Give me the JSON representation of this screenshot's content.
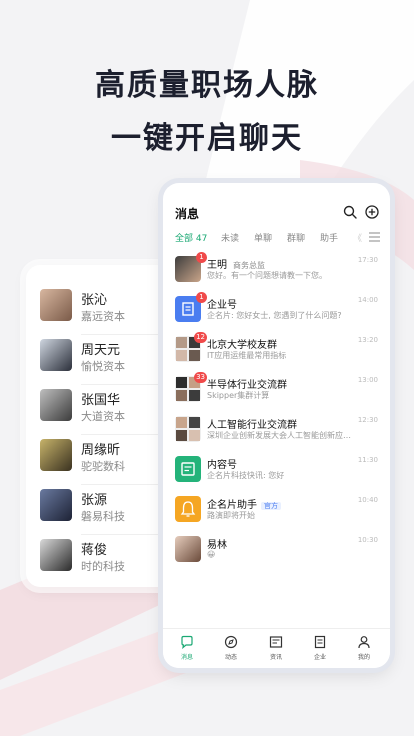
{
  "headline": {
    "line1": "高质量职场人脉",
    "line2": "一键开启聊天"
  },
  "contacts": [
    {
      "name": "张沁",
      "company": "嘉远资本"
    },
    {
      "name": "周天元",
      "company": "愉悦资本"
    },
    {
      "name": "张国华",
      "company": "大道资本"
    },
    {
      "name": "周缘昕",
      "company": "驼驼数科"
    },
    {
      "name": "张源",
      "company": "磐易科技"
    },
    {
      "name": "蒋俊",
      "company": "时的科技"
    }
  ],
  "phone": {
    "title": "消息",
    "tabs": [
      "全部 47",
      "未读",
      "单聊",
      "群聊",
      "助手",
      "《"
    ],
    "messages": [
      {
        "name": "王明",
        "role": "商务总监",
        "tag": "",
        "preview": "您好。有一个问题想请教一下您。",
        "time": "17:30",
        "badge": "1"
      },
      {
        "name": "企业号",
        "role": "",
        "tag": "",
        "preview": "企名片: 您好女士, 您遇到了什么问题?",
        "time": "14:00",
        "badge": "1"
      },
      {
        "name": "北京大学校友群",
        "role": "",
        "tag": "",
        "preview": "IT应用运维最常用指标",
        "time": "13:20",
        "badge": "12"
      },
      {
        "name": "半导体行业交流群",
        "role": "",
        "tag": "",
        "preview": "Skipper集群计算",
        "time": "13:00",
        "badge": "33"
      },
      {
        "name": "人工智能行业交流群",
        "role": "",
        "tag": "",
        "preview": "深圳企业创新发展大会人工智能创新应用论...",
        "time": "12:30",
        "badge": ""
      },
      {
        "name": "内容号",
        "role": "",
        "tag": "",
        "preview": "企名片科技快讯: 您好",
        "time": "11:30",
        "badge": ""
      },
      {
        "name": "企名片助手",
        "role": "",
        "tag": "官方",
        "preview": "路演即将开始",
        "time": "10:40",
        "badge": ""
      },
      {
        "name": "易林",
        "role": "",
        "tag": "",
        "preview": "😀",
        "time": "10:30",
        "badge": ""
      }
    ],
    "nav": [
      "消息",
      "动态",
      "资讯",
      "企业",
      "我的"
    ]
  },
  "colors": {
    "accent": "#1aa873",
    "badge": "#f04a4a",
    "blue_icon": "#4a7df0",
    "green_icon": "#24b37a",
    "orange_icon": "#f5a623"
  },
  "icons": [
    "search-icon",
    "plus-circle-icon",
    "menu-icon",
    "message-icon",
    "compass-icon",
    "news-icon",
    "enterprise-icon",
    "user-icon"
  ]
}
